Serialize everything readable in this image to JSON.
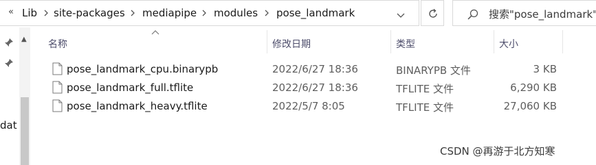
{
  "address_bar": {
    "overflow_symbol": "«",
    "crumbs": [
      "Lib",
      "site-packages",
      "mediapipe",
      "modules",
      "pose_landmark"
    ]
  },
  "search": {
    "placeholder": "搜索\"pose_landmark\""
  },
  "nav_pane": {
    "clipped_label": "dat"
  },
  "columns": {
    "name": "名称",
    "date": "修改日期",
    "type": "类型",
    "size": "大小"
  },
  "files": [
    {
      "name": "pose_landmark_cpu.binarypb",
      "date": "2022/6/27 18:36",
      "type": "BINARYPB 文件",
      "size": "3 KB"
    },
    {
      "name": "pose_landmark_full.tflite",
      "date": "2022/6/27 18:36",
      "type": "TFLITE 文件",
      "size": "6,290 KB"
    },
    {
      "name": "pose_landmark_heavy.tflite",
      "date": "2022/5/7 8:05",
      "type": "TFLITE 文件",
      "size": "27,060 KB"
    }
  ],
  "watermark": "CSDN @再游于北方知寒",
  "icons": [
    "chevron-right-icon",
    "chevron-down-icon",
    "refresh-icon",
    "search-icon",
    "pin-icon",
    "file-icon",
    "scroll-up-icon"
  ]
}
